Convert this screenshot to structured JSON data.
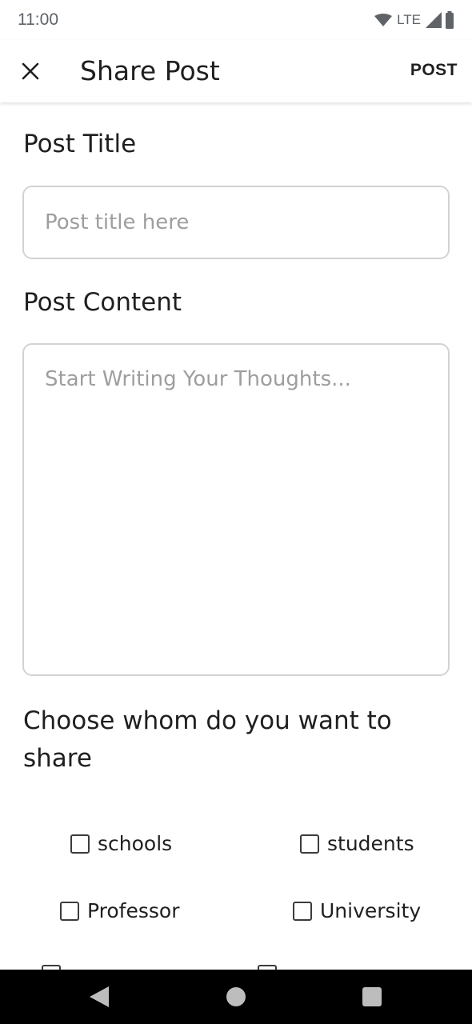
{
  "status_bar": {
    "time": "11:00",
    "network": "LTE"
  },
  "app_bar": {
    "title": "Share Post",
    "post_label": "POST"
  },
  "form": {
    "title_label": "Post Title",
    "title_placeholder": "Post title here",
    "title_value": "",
    "content_label": "Post Content",
    "content_placeholder": "Start Writing Your Thoughts...",
    "content_value": "",
    "share_label": "Choose whom do you want to share",
    "audience_options": [
      {
        "label": "schools",
        "checked": false
      },
      {
        "label": "students",
        "checked": false
      },
      {
        "label": "Professor",
        "checked": false
      },
      {
        "label": "University",
        "checked": false
      }
    ]
  }
}
